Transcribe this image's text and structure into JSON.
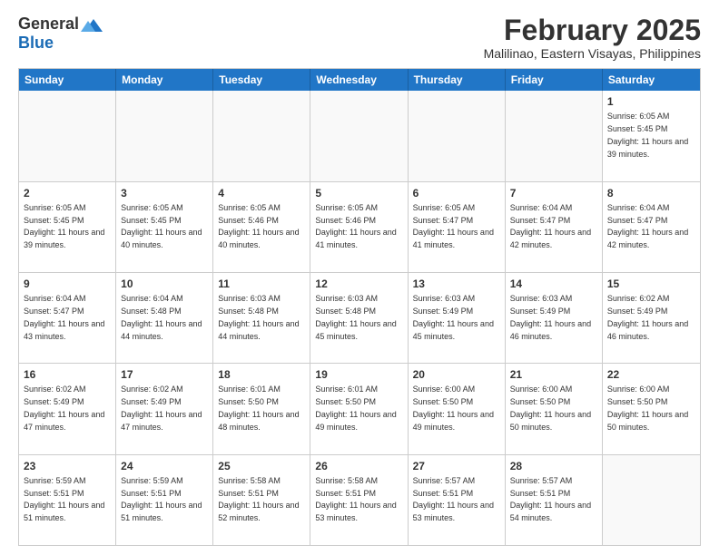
{
  "logo": {
    "general": "General",
    "blue": "Blue"
  },
  "header": {
    "title": "February 2025",
    "subtitle": "Malilinao, Eastern Visayas, Philippines"
  },
  "weekdays": [
    "Sunday",
    "Monday",
    "Tuesday",
    "Wednesday",
    "Thursday",
    "Friday",
    "Saturday"
  ],
  "weeks": [
    [
      {
        "day": "",
        "sunrise": "",
        "sunset": "",
        "daylight": "",
        "empty": true
      },
      {
        "day": "",
        "sunrise": "",
        "sunset": "",
        "daylight": "",
        "empty": true
      },
      {
        "day": "",
        "sunrise": "",
        "sunset": "",
        "daylight": "",
        "empty": true
      },
      {
        "day": "",
        "sunrise": "",
        "sunset": "",
        "daylight": "",
        "empty": true
      },
      {
        "day": "",
        "sunrise": "",
        "sunset": "",
        "daylight": "",
        "empty": true
      },
      {
        "day": "",
        "sunrise": "",
        "sunset": "",
        "daylight": "",
        "empty": true
      },
      {
        "day": "1",
        "sunrise": "Sunrise: 6:05 AM",
        "sunset": "Sunset: 5:45 PM",
        "daylight": "Daylight: 11 hours and 39 minutes.",
        "empty": false
      }
    ],
    [
      {
        "day": "2",
        "sunrise": "Sunrise: 6:05 AM",
        "sunset": "Sunset: 5:45 PM",
        "daylight": "Daylight: 11 hours and 39 minutes.",
        "empty": false
      },
      {
        "day": "3",
        "sunrise": "Sunrise: 6:05 AM",
        "sunset": "Sunset: 5:45 PM",
        "daylight": "Daylight: 11 hours and 40 minutes.",
        "empty": false
      },
      {
        "day": "4",
        "sunrise": "Sunrise: 6:05 AM",
        "sunset": "Sunset: 5:46 PM",
        "daylight": "Daylight: 11 hours and 40 minutes.",
        "empty": false
      },
      {
        "day": "5",
        "sunrise": "Sunrise: 6:05 AM",
        "sunset": "Sunset: 5:46 PM",
        "daylight": "Daylight: 11 hours and 41 minutes.",
        "empty": false
      },
      {
        "day": "6",
        "sunrise": "Sunrise: 6:05 AM",
        "sunset": "Sunset: 5:47 PM",
        "daylight": "Daylight: 11 hours and 41 minutes.",
        "empty": false
      },
      {
        "day": "7",
        "sunrise": "Sunrise: 6:04 AM",
        "sunset": "Sunset: 5:47 PM",
        "daylight": "Daylight: 11 hours and 42 minutes.",
        "empty": false
      },
      {
        "day": "8",
        "sunrise": "Sunrise: 6:04 AM",
        "sunset": "Sunset: 5:47 PM",
        "daylight": "Daylight: 11 hours and 42 minutes.",
        "empty": false
      }
    ],
    [
      {
        "day": "9",
        "sunrise": "Sunrise: 6:04 AM",
        "sunset": "Sunset: 5:47 PM",
        "daylight": "Daylight: 11 hours and 43 minutes.",
        "empty": false
      },
      {
        "day": "10",
        "sunrise": "Sunrise: 6:04 AM",
        "sunset": "Sunset: 5:48 PM",
        "daylight": "Daylight: 11 hours and 44 minutes.",
        "empty": false
      },
      {
        "day": "11",
        "sunrise": "Sunrise: 6:03 AM",
        "sunset": "Sunset: 5:48 PM",
        "daylight": "Daylight: 11 hours and 44 minutes.",
        "empty": false
      },
      {
        "day": "12",
        "sunrise": "Sunrise: 6:03 AM",
        "sunset": "Sunset: 5:48 PM",
        "daylight": "Daylight: 11 hours and 45 minutes.",
        "empty": false
      },
      {
        "day": "13",
        "sunrise": "Sunrise: 6:03 AM",
        "sunset": "Sunset: 5:49 PM",
        "daylight": "Daylight: 11 hours and 45 minutes.",
        "empty": false
      },
      {
        "day": "14",
        "sunrise": "Sunrise: 6:03 AM",
        "sunset": "Sunset: 5:49 PM",
        "daylight": "Daylight: 11 hours and 46 minutes.",
        "empty": false
      },
      {
        "day": "15",
        "sunrise": "Sunrise: 6:02 AM",
        "sunset": "Sunset: 5:49 PM",
        "daylight": "Daylight: 11 hours and 46 minutes.",
        "empty": false
      }
    ],
    [
      {
        "day": "16",
        "sunrise": "Sunrise: 6:02 AM",
        "sunset": "Sunset: 5:49 PM",
        "daylight": "Daylight: 11 hours and 47 minutes.",
        "empty": false
      },
      {
        "day": "17",
        "sunrise": "Sunrise: 6:02 AM",
        "sunset": "Sunset: 5:49 PM",
        "daylight": "Daylight: 11 hours and 47 minutes.",
        "empty": false
      },
      {
        "day": "18",
        "sunrise": "Sunrise: 6:01 AM",
        "sunset": "Sunset: 5:50 PM",
        "daylight": "Daylight: 11 hours and 48 minutes.",
        "empty": false
      },
      {
        "day": "19",
        "sunrise": "Sunrise: 6:01 AM",
        "sunset": "Sunset: 5:50 PM",
        "daylight": "Daylight: 11 hours and 49 minutes.",
        "empty": false
      },
      {
        "day": "20",
        "sunrise": "Sunrise: 6:00 AM",
        "sunset": "Sunset: 5:50 PM",
        "daylight": "Daylight: 11 hours and 49 minutes.",
        "empty": false
      },
      {
        "day": "21",
        "sunrise": "Sunrise: 6:00 AM",
        "sunset": "Sunset: 5:50 PM",
        "daylight": "Daylight: 11 hours and 50 minutes.",
        "empty": false
      },
      {
        "day": "22",
        "sunrise": "Sunrise: 6:00 AM",
        "sunset": "Sunset: 5:50 PM",
        "daylight": "Daylight: 11 hours and 50 minutes.",
        "empty": false
      }
    ],
    [
      {
        "day": "23",
        "sunrise": "Sunrise: 5:59 AM",
        "sunset": "Sunset: 5:51 PM",
        "daylight": "Daylight: 11 hours and 51 minutes.",
        "empty": false
      },
      {
        "day": "24",
        "sunrise": "Sunrise: 5:59 AM",
        "sunset": "Sunset: 5:51 PM",
        "daylight": "Daylight: 11 hours and 51 minutes.",
        "empty": false
      },
      {
        "day": "25",
        "sunrise": "Sunrise: 5:58 AM",
        "sunset": "Sunset: 5:51 PM",
        "daylight": "Daylight: 11 hours and 52 minutes.",
        "empty": false
      },
      {
        "day": "26",
        "sunrise": "Sunrise: 5:58 AM",
        "sunset": "Sunset: 5:51 PM",
        "daylight": "Daylight: 11 hours and 53 minutes.",
        "empty": false
      },
      {
        "day": "27",
        "sunrise": "Sunrise: 5:57 AM",
        "sunset": "Sunset: 5:51 PM",
        "daylight": "Daylight: 11 hours and 53 minutes.",
        "empty": false
      },
      {
        "day": "28",
        "sunrise": "Sunrise: 5:57 AM",
        "sunset": "Sunset: 5:51 PM",
        "daylight": "Daylight: 11 hours and 54 minutes.",
        "empty": false
      },
      {
        "day": "",
        "sunrise": "",
        "sunset": "",
        "daylight": "",
        "empty": true
      }
    ]
  ]
}
